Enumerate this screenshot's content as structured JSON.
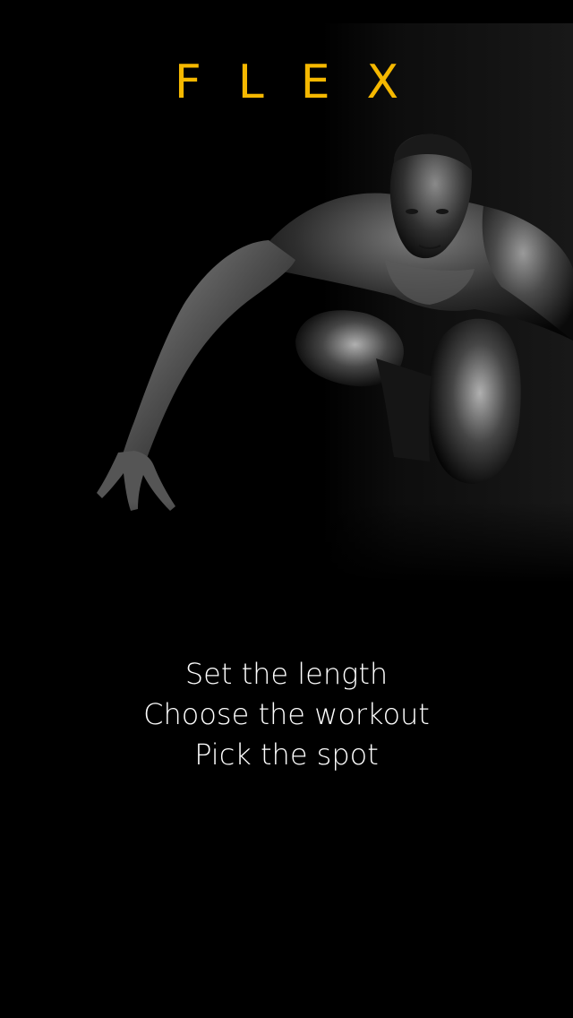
{
  "brand": {
    "title": "FLEX",
    "color": "#F5B800"
  },
  "hero": {
    "image": "man-crouching-workout-photo",
    "tone": "black-and-white"
  },
  "taglines": {
    "line1": "Set the length",
    "line2": "Choose the workout",
    "line3": "Pick the spot",
    "color": "#FFFFFF"
  },
  "background": "#000000"
}
